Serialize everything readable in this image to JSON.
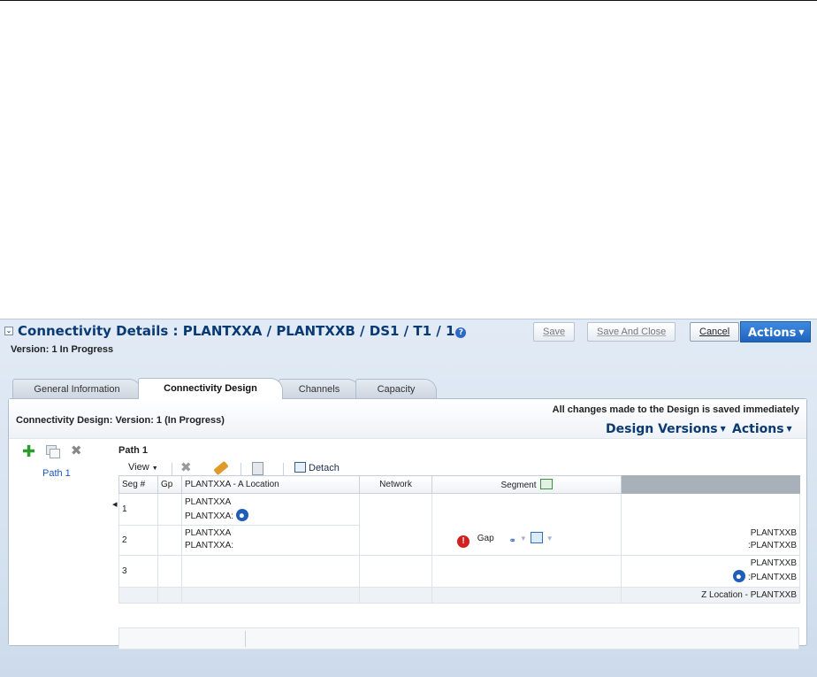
{
  "header": {
    "title": "Connectivity Details : PLANTXXA / PLANTXXB / DS1 / T1 / 1",
    "version": "Version: 1 In Progress",
    "help_glyph": "?",
    "save_label": "Save",
    "save_close_label": "Save And Close",
    "cancel_label": "Cancel",
    "actions_label": "Actions"
  },
  "tabs": [
    {
      "label": "General Information",
      "active": false
    },
    {
      "label": "Connectivity Design",
      "active": true
    },
    {
      "label": "Channels",
      "active": false
    },
    {
      "label": "Capacity",
      "active": false
    }
  ],
  "design": {
    "title": "Connectivity Design: Version: 1 (In Progress)",
    "saved_notice": "All changes made to the Design is saved immediately",
    "design_versions_label": "Design Versions",
    "actions_label": "Actions"
  },
  "paths": {
    "items": [
      {
        "label": "Path 1"
      }
    ]
  },
  "path_panel": {
    "title": "Path 1",
    "view_label": "View",
    "detach_label": "Detach"
  },
  "table": {
    "columns": [
      "Seg #",
      "Gp",
      "PLANTXXA - A Location",
      "Network",
      "Segment"
    ],
    "rows": [
      {
        "seg": "1",
        "a_line1": "PLANTXXA",
        "a_line2": "PLANTXXA:",
        "z_line1": "",
        "z_line2": ""
      },
      {
        "seg": "2",
        "a_line1": "PLANTXXA",
        "a_line2": "PLANTXXA:",
        "segment_text": "Gap",
        "z_line1": "PLANTXXB",
        "z_line2": ":PLANTXXB"
      },
      {
        "seg": "3",
        "a_line1": "",
        "a_line2": "",
        "z_line1": "PLANTXXB",
        "z_line2": ":PLANTXXB"
      }
    ],
    "footer_z": "Z Location - PLANTXXB"
  },
  "icons": {
    "add": "plus-icon",
    "copy": "copy-icon",
    "delete": "delete-icon",
    "gap": "error-icon",
    "location": "location-pin-icon"
  },
  "colors": {
    "brand_blue": "#0a3a74",
    "actions_button": "#2a73d4",
    "panel_bg": "#d4e1ef",
    "gap_red": "#d31f1f",
    "add_green": "#2e9b2e"
  }
}
